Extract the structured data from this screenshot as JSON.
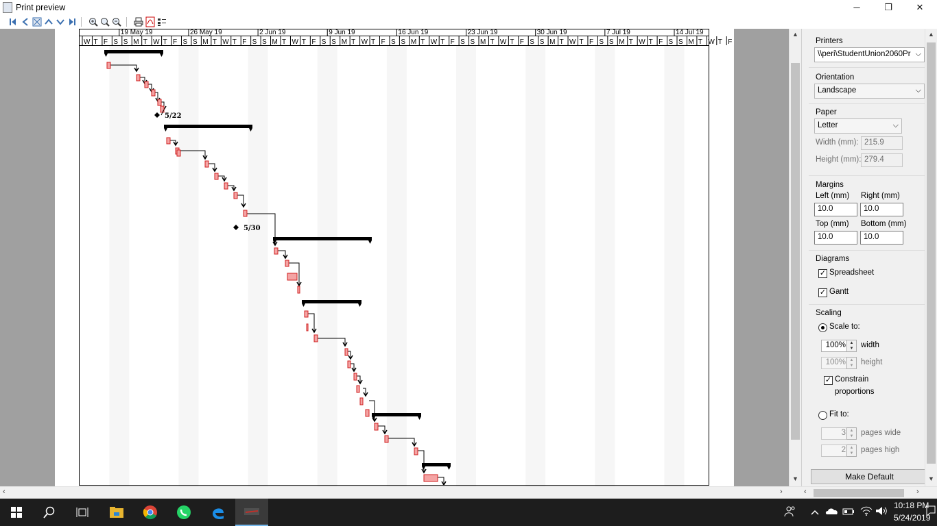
{
  "window": {
    "title": "Print preview",
    "minimize": "─",
    "maximize": "❐",
    "close": "✕"
  },
  "toolbar": {
    "icons": [
      "first-page-icon",
      "previous-page-icon",
      "fit-page-icon",
      "scroll-up-icon",
      "scroll-down-icon",
      "last-page-icon",
      "zoom-in-icon",
      "zoom-reset-icon",
      "zoom-out-icon",
      "print-icon",
      "pdf-icon",
      "settings-icon"
    ]
  },
  "gantt": {
    "week_labels": [
      "19 May 19",
      "26 May 19",
      "2 Jun 19",
      "9 Jun 19",
      "16 Jun 19",
      "23 Jun 19",
      "30 Jun 19",
      "7 Jul 19",
      "14 Jul 19"
    ],
    "day_letters": [
      "W",
      "T",
      "F",
      "S",
      "S",
      "M",
      "T",
      "W",
      "T",
      "F",
      "S",
      "S",
      "M",
      "T",
      "W",
      "T",
      "F",
      "S",
      "S",
      "M",
      "T",
      "W",
      "T",
      "F",
      "S",
      "S",
      "M",
      "T",
      "W",
      "T",
      "F",
      "S",
      "S",
      "M",
      "T",
      "W",
      "T",
      "F",
      "S",
      "S",
      "M",
      "T",
      "W",
      "T",
      "F",
      "S",
      "S",
      "M",
      "T",
      "W",
      "T",
      "F",
      "S",
      "S",
      "M",
      "T",
      "W",
      "T",
      "F",
      "S",
      "S",
      "M",
      "T",
      "W",
      "T",
      "F",
      "S",
      "S",
      "M",
      "T"
    ],
    "milestones": [
      {
        "label": "5/22"
      },
      {
        "label": "5/30"
      }
    ]
  },
  "panel": {
    "printers": {
      "label": "Printers",
      "value": "\\\\peri\\StudentUnion2060Pr"
    },
    "orientation": {
      "label": "Orientation",
      "value": "Landscape"
    },
    "paper": {
      "label": "Paper",
      "value": "Letter",
      "width_label": "Width (mm):",
      "width_value": "215.9",
      "height_label": "Height (mm):",
      "height_value": "279.4"
    },
    "margins": {
      "label": "Margins",
      "left_label": "Left (mm)",
      "left_value": "10.0",
      "right_label": "Right (mm)",
      "right_value": "10.0",
      "top_label": "Top (mm)",
      "top_value": "10.0",
      "bottom_label": "Bottom (mm)",
      "bottom_value": "10.0"
    },
    "diagrams": {
      "label": "Diagrams",
      "spreadsheet": "Spreadsheet",
      "spreadsheet_checked": true,
      "gantt": "Gantt",
      "gantt_checked": true
    },
    "scaling": {
      "label": "Scaling",
      "scale_to": "Scale to:",
      "scale_selected": true,
      "width_value": "100%",
      "width_label": "width",
      "height_value": "100%",
      "height_label": "height",
      "constrain_line1": "Constrain",
      "constrain_line2": "proportions",
      "constrain_checked": true,
      "fit_to": "Fit to:",
      "pages_wide_value": "3",
      "pages_wide_label": "pages wide",
      "pages_high_value": "2",
      "pages_high_label": "pages high"
    },
    "make_default": "Make Default"
  },
  "taskbar": {
    "apps": [
      "windows-start-icon",
      "search-icon",
      "task-view-icon",
      "file-explorer-icon",
      "chrome-icon",
      "whatsapp-icon",
      "edge-icon",
      "java-app-icon"
    ],
    "time": "10:18 PM",
    "date": "5/24/2019"
  },
  "colors": {
    "task_fill": "#f4a4a4",
    "task_border": "#d02020",
    "summary": "#000000",
    "weekend_shade": "#f6f6f6"
  }
}
